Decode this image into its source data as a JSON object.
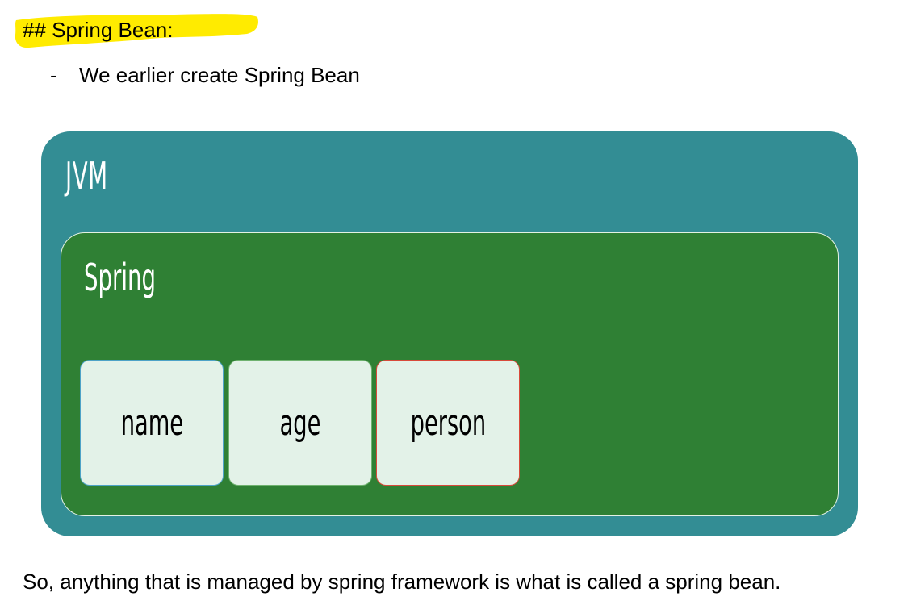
{
  "heading": "## Spring Bean:",
  "highlight_color": "#ffeb00",
  "bullet": {
    "marker": "-",
    "text": "We earlier create Spring Bean"
  },
  "diagram": {
    "outer": {
      "label": "JVM",
      "color": "#338d94"
    },
    "inner": {
      "label": "Spring",
      "color": "#2f8034"
    },
    "beans": [
      {
        "label": "name",
        "border_color": "#4da3c7"
      },
      {
        "label": "age",
        "border_color": "#6fb26f"
      },
      {
        "label": "person",
        "border_color": "#d84a3a"
      }
    ]
  },
  "conclusion": "So, anything that is managed by spring framework is what is called a spring bean."
}
